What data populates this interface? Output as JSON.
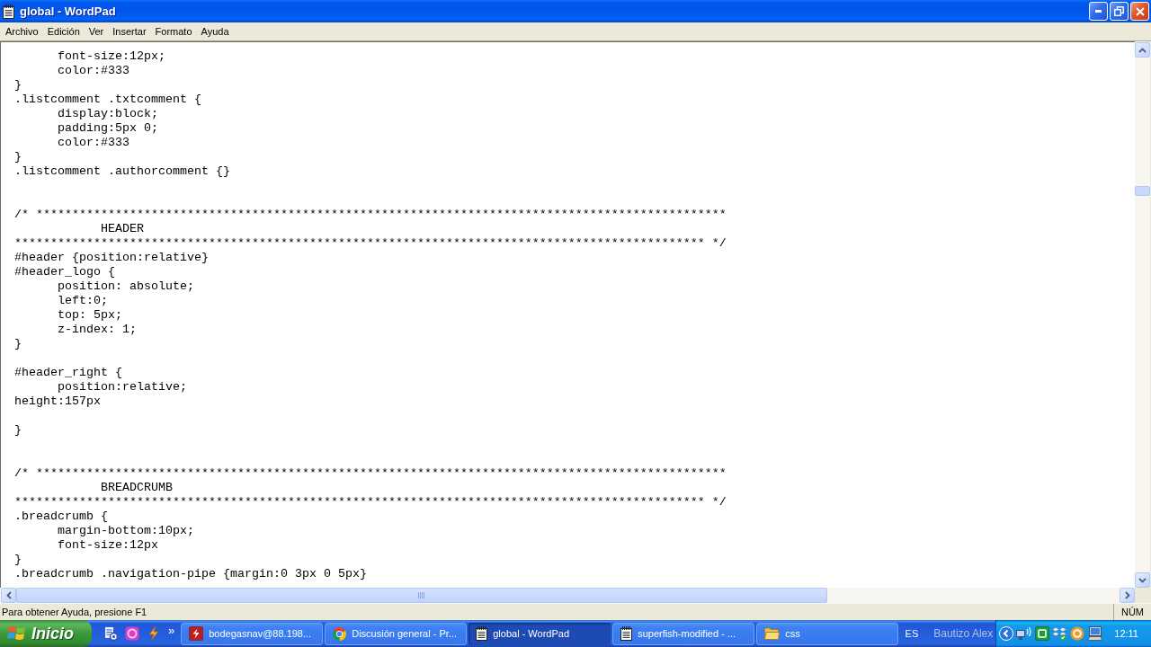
{
  "window": {
    "title": "global - WordPad"
  },
  "menu": [
    "Archivo",
    "Edición",
    "Ver",
    "Insertar",
    "Formato",
    "Ayuda"
  ],
  "document": {
    "lines": [
      {
        "kind": "code",
        "text": "\tfont-size:12px;"
      },
      {
        "kind": "code",
        "text": "\tcolor:#333"
      },
      {
        "kind": "code",
        "text": "}"
      },
      {
        "kind": "code",
        "text": ".listcomment .txtcomment {"
      },
      {
        "kind": "code",
        "text": "\tdisplay:block;"
      },
      {
        "kind": "code",
        "text": "\tpadding:5px 0;"
      },
      {
        "kind": "code",
        "text": "\tcolor:#333"
      },
      {
        "kind": "code",
        "text": "}"
      },
      {
        "kind": "code",
        "text": ".listcomment .authorcomment {}"
      },
      {
        "kind": "blank"
      },
      {
        "kind": "blank"
      },
      {
        "kind": "code",
        "text": "/* ************************************************************************************************"
      },
      {
        "kind": "code",
        "text": "\t\tHEADER"
      },
      {
        "kind": "code",
        "text": "************************************************************************************************ */"
      },
      {
        "kind": "code",
        "text": "#header {position:relative}"
      },
      {
        "kind": "code",
        "text": "#header_logo {"
      },
      {
        "kind": "code",
        "text": "\tposition: absolute;"
      },
      {
        "kind": "code",
        "text": "\tleft:0;"
      },
      {
        "kind": "code",
        "text": "\ttop: 5px;"
      },
      {
        "kind": "code",
        "text": "\tz-index: 1;"
      },
      {
        "kind": "code",
        "text": "}"
      },
      {
        "kind": "blank"
      },
      {
        "kind": "code",
        "text": "#header_right {"
      },
      {
        "kind": "code",
        "text": "\tposition:relative;"
      },
      {
        "kind": "code",
        "text": "height:157px"
      },
      {
        "kind": "blank"
      },
      {
        "kind": "code",
        "text": "}"
      },
      {
        "kind": "blank"
      },
      {
        "kind": "blank"
      },
      {
        "kind": "code",
        "text": "/* ************************************************************************************************"
      },
      {
        "kind": "code",
        "text": "\t\tBREADCRUMB"
      },
      {
        "kind": "code",
        "text": "************************************************************************************************ */"
      },
      {
        "kind": "code",
        "text": ".breadcrumb {"
      },
      {
        "kind": "code",
        "text": "\tmargin-bottom:10px;"
      },
      {
        "kind": "code",
        "text": "\tfont-size:12px"
      },
      {
        "kind": "code",
        "text": "}"
      },
      {
        "kind": "code",
        "text": ".breadcrumb .navigation-pipe {margin:0 3px 0 5px}"
      }
    ]
  },
  "status_bar": {
    "help_text": "Para obtener Ayuda, presione F1",
    "indicator": "NÚM"
  },
  "taskbar": {
    "start_label": "Inicio",
    "quick_launch_more": "»",
    "tasks": [
      {
        "kind": "ftp",
        "label": "bodegasnav@88.198...",
        "selected": false
      },
      {
        "kind": "browser",
        "label": "Discusión general - Pr...",
        "selected": false
      },
      {
        "kind": "notepad",
        "label": "global - WordPad",
        "selected": true
      },
      {
        "kind": "notepad",
        "label": "superfish-modified - ...",
        "selected": false
      },
      {
        "kind": "folder",
        "label": "css",
        "selected": false
      }
    ],
    "language": "ES",
    "user": "Bautizo Alex",
    "clock": "12:11"
  }
}
